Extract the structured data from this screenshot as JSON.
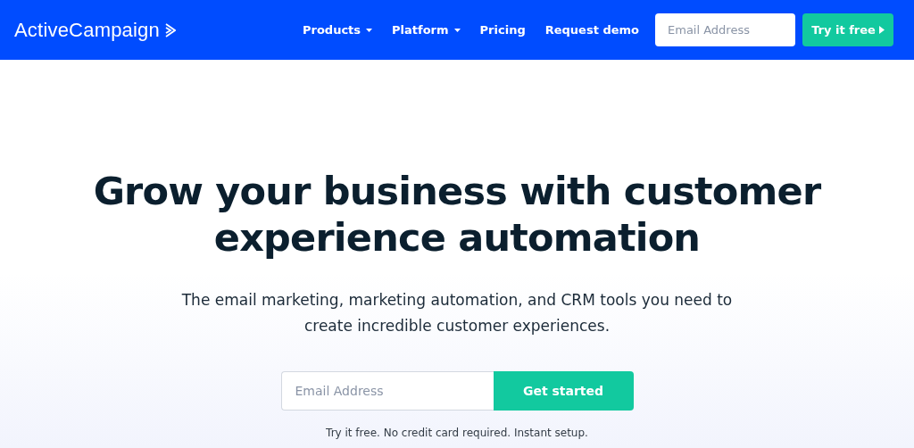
{
  "header": {
    "logo": "ActiveCampaign",
    "nav": [
      {
        "label": "Products",
        "has_menu": true
      },
      {
        "label": "Platform",
        "has_menu": true
      },
      {
        "label": "Pricing",
        "has_menu": false
      },
      {
        "label": "Request demo",
        "has_menu": false
      }
    ],
    "email": {
      "placeholder": "Email Address"
    },
    "cta": "Try it free"
  },
  "hero": {
    "title": "Grow your business with customer experience automation",
    "subtitle": "The email marketing, marketing automation, and CRM tools you need to create incredible customer experiences.",
    "email": {
      "placeholder": "Email Address"
    },
    "button": "Get started",
    "note": "Try it free. No credit card required. Instant setup."
  }
}
